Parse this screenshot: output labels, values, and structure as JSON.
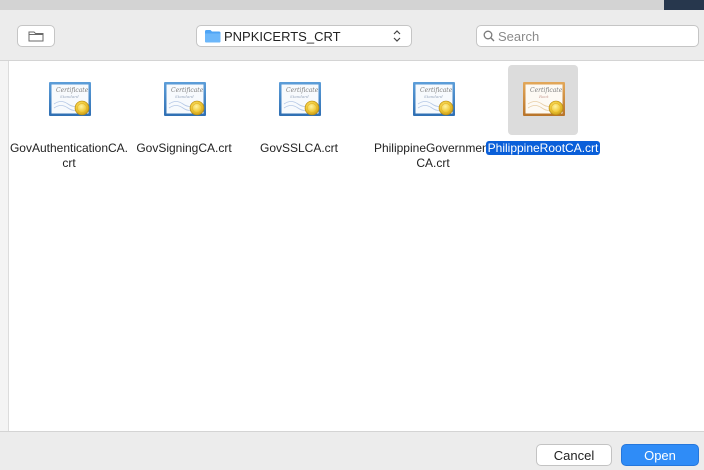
{
  "toolbar": {
    "new_folder_icon": "new-folder-icon",
    "location": {
      "label": "PNPKICERTS_CRT",
      "icon": "folder-icon",
      "arrows_icon": "up-down-chevron-icon"
    },
    "search": {
      "placeholder": "Search",
      "value": "",
      "icon": "search-icon"
    }
  },
  "files": [
    {
      "name": "GovAuthenticationCA.crt",
      "icon": "certificate-standard-icon",
      "selected": false
    },
    {
      "name": "GovSigningCA.crt",
      "icon": "certificate-standard-icon",
      "selected": false
    },
    {
      "name": "GovSSLCA.crt",
      "icon": "certificate-standard-icon",
      "selected": false
    },
    {
      "name": "PhilippineGovernmentCA.crt",
      "icon": "certificate-standard-icon",
      "selected": false
    },
    {
      "name": "PhilippineRootCA.crt",
      "icon": "certificate-root-icon",
      "selected": true
    }
  ],
  "certificate_text": {
    "header": "Certificate",
    "standard": "Standard",
    "root": "Root"
  },
  "buttons": {
    "cancel_label": "Cancel",
    "open_label": "Open"
  },
  "colors": {
    "selection": "#0a5fd9",
    "open_button": "#2f8cf7",
    "toolbar_bg": "#ececec"
  }
}
